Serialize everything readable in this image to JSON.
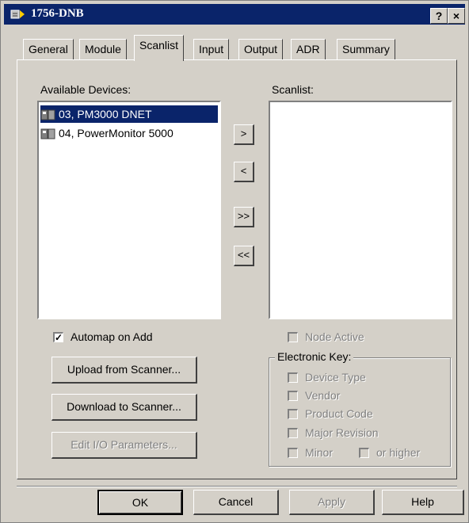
{
  "window": {
    "title": "1756-DNB",
    "help_label": "?",
    "close_label": "×"
  },
  "tabs": [
    {
      "label": "General"
    },
    {
      "label": "Module"
    },
    {
      "label": "Scanlist",
      "active": true
    },
    {
      "label": "Input"
    },
    {
      "label": "Output"
    },
    {
      "label": "ADR"
    },
    {
      "label": "Summary"
    }
  ],
  "available": {
    "label": "Available Devices:",
    "items": [
      {
        "text": "03, PM3000 DNET",
        "selected": true,
        "icon": "device-icon"
      },
      {
        "text": "04, PowerMonitor 5000",
        "selected": false,
        "icon": "device-icon"
      }
    ]
  },
  "scanlist": {
    "label": "Scanlist:",
    "items": []
  },
  "move_buttons": {
    "add": ">",
    "remove": "<",
    "add_all": ">>",
    "remove_all": "<<"
  },
  "automap": {
    "label": "Automap on Add",
    "checked": true
  },
  "actions": {
    "upload": "Upload from Scanner...",
    "download": "Download to Scanner...",
    "edit_io": "Edit I/O Parameters..."
  },
  "node_active": {
    "label": "Node Active",
    "checked": false
  },
  "electronic_key": {
    "title": "Electronic Key:",
    "device_type": "Device Type",
    "vendor": "Vendor",
    "product_code": "Product Code",
    "major_revision": "Major Revision",
    "minor": "Minor",
    "or_higher": "or higher"
  },
  "footer": {
    "ok": "OK",
    "cancel": "Cancel",
    "apply": "Apply",
    "help": "Help"
  }
}
